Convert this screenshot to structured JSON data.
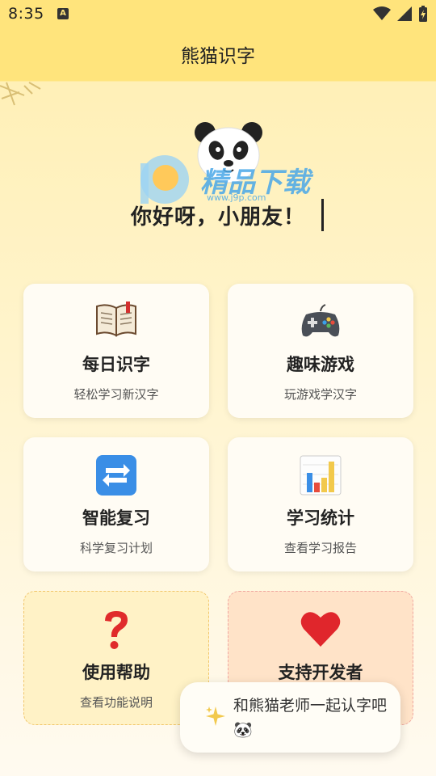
{
  "status_bar": {
    "time": "8:35",
    "notification_icon": "a-icon"
  },
  "header": {
    "title": "熊猫识字"
  },
  "hero": {
    "greeting": "你好呀，小朋友！",
    "watermark_text": "精品下载",
    "watermark_url": "www.j9p.com"
  },
  "cards": [
    {
      "title": "每日识字",
      "subtitle": "轻松学习新汉字",
      "icon": "book-icon"
    },
    {
      "title": "趣味游戏",
      "subtitle": "玩游戏学汉字",
      "icon": "gamepad-icon"
    },
    {
      "title": "智能复习",
      "subtitle": "科学复习计划",
      "icon": "repeat-icon"
    },
    {
      "title": "学习统计",
      "subtitle": "查看学习报告",
      "icon": "bar-chart-icon"
    },
    {
      "title": "使用帮助",
      "subtitle": "查看功能说明",
      "icon": "question-icon"
    },
    {
      "title": "支持开发者",
      "subtitle": "",
      "icon": "heart-icon"
    }
  ],
  "toast": {
    "message": "和熊猫老师一起认字吧 🐼"
  },
  "colors": {
    "header": "#ffe47c",
    "card": "#fffcf4",
    "help_card": "#fff2c6",
    "support_card": "#ffe3c8"
  }
}
